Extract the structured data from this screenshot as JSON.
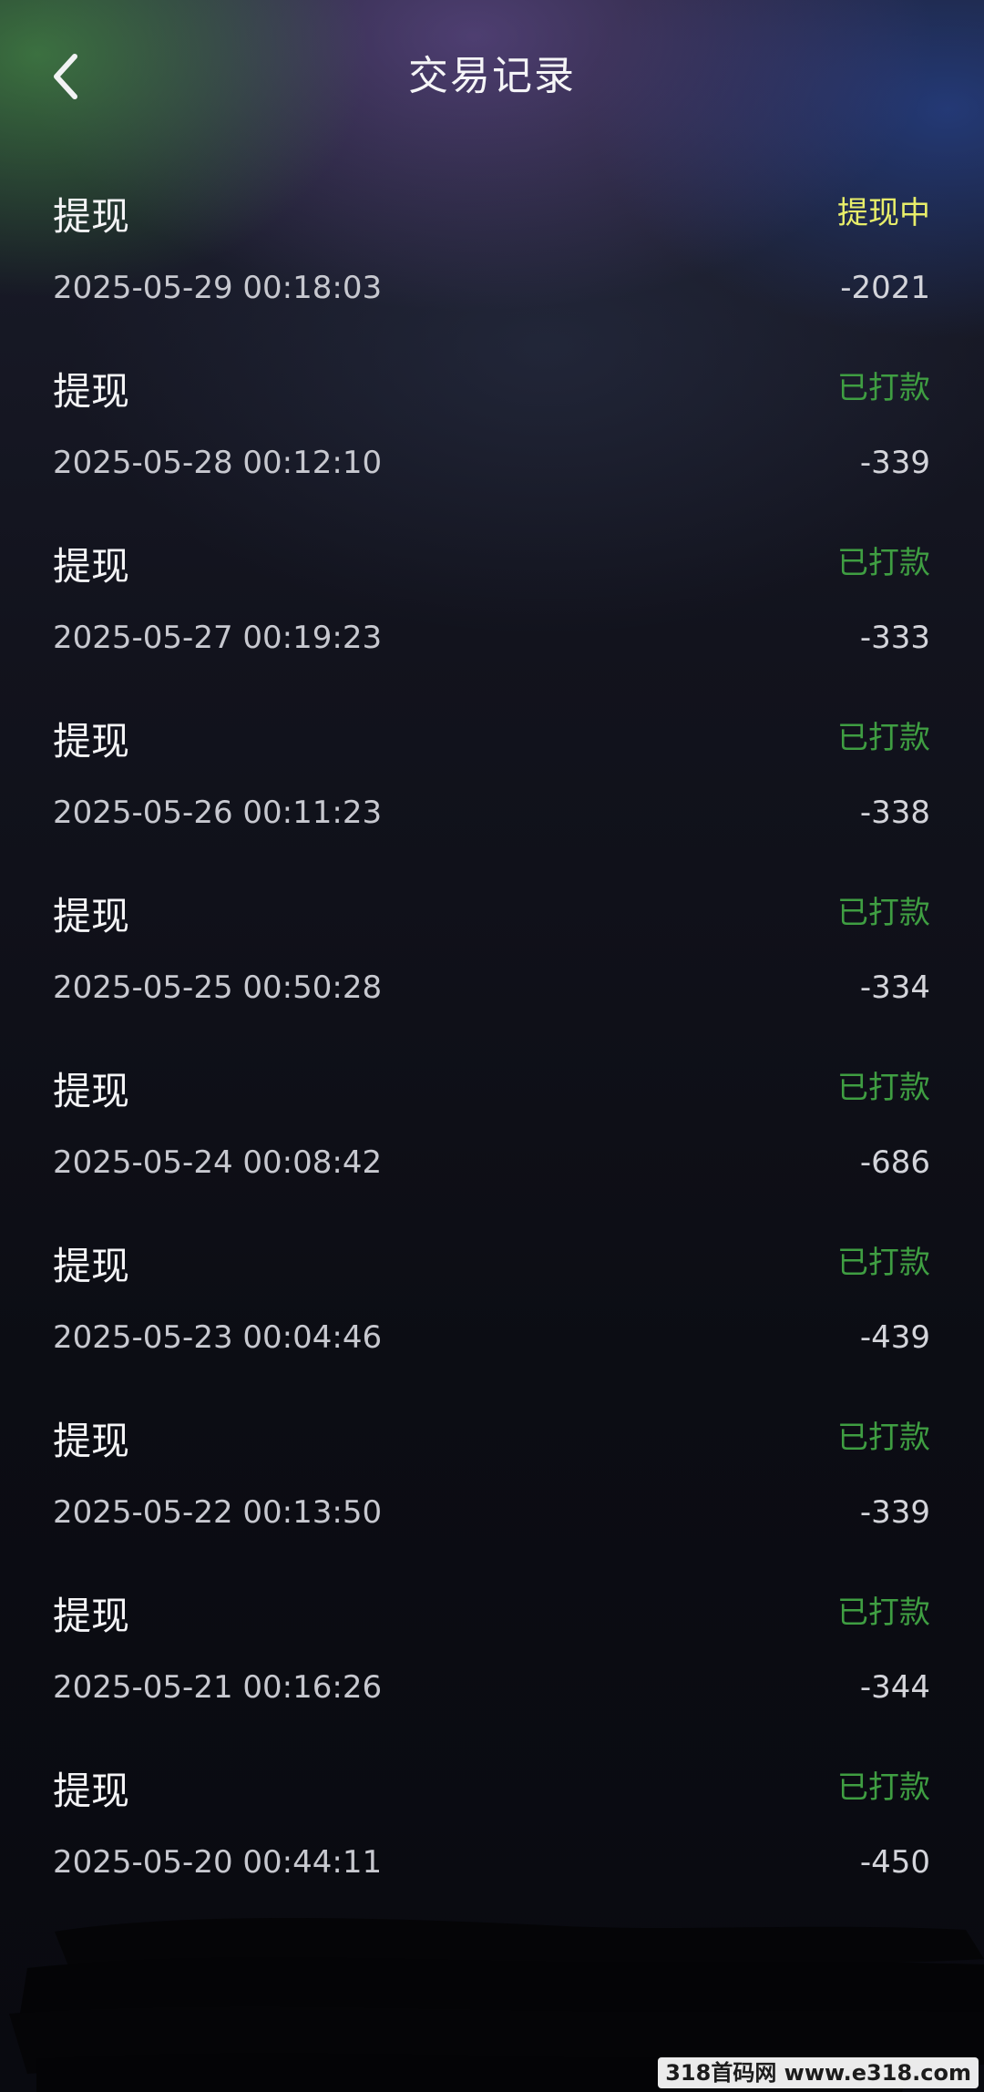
{
  "header": {
    "title": "交易记录",
    "back_icon": "chevron-left-icon"
  },
  "colors": {
    "status_pending": "#e8ee6a",
    "status_paid": "#3f9e42"
  },
  "transactions": [
    {
      "type": "提现",
      "status": "提现中",
      "status_kind": "pending",
      "time": "2025-05-29 00:18:03",
      "amount": "-2021"
    },
    {
      "type": "提现",
      "status": "已打款",
      "status_kind": "paid",
      "time": "2025-05-28 00:12:10",
      "amount": "-339"
    },
    {
      "type": "提现",
      "status": "已打款",
      "status_kind": "paid",
      "time": "2025-05-27 00:19:23",
      "amount": "-333"
    },
    {
      "type": "提现",
      "status": "已打款",
      "status_kind": "paid",
      "time": "2025-05-26 00:11:23",
      "amount": "-338"
    },
    {
      "type": "提现",
      "status": "已打款",
      "status_kind": "paid",
      "time": "2025-05-25 00:50:28",
      "amount": "-334"
    },
    {
      "type": "提现",
      "status": "已打款",
      "status_kind": "paid",
      "time": "2025-05-24 00:08:42",
      "amount": "-686"
    },
    {
      "type": "提现",
      "status": "已打款",
      "status_kind": "paid",
      "time": "2025-05-23 00:04:46",
      "amount": "-439"
    },
    {
      "type": "提现",
      "status": "已打款",
      "status_kind": "paid",
      "time": "2025-05-22 00:13:50",
      "amount": "-339"
    },
    {
      "type": "提现",
      "status": "已打款",
      "status_kind": "paid",
      "time": "2025-05-21 00:16:26",
      "amount": "-344"
    },
    {
      "type": "提现",
      "status": "已打款",
      "status_kind": "paid",
      "time": "2025-05-20 00:44:11",
      "amount": "-450"
    }
  ],
  "watermark": "318首码网 www.e318.com"
}
